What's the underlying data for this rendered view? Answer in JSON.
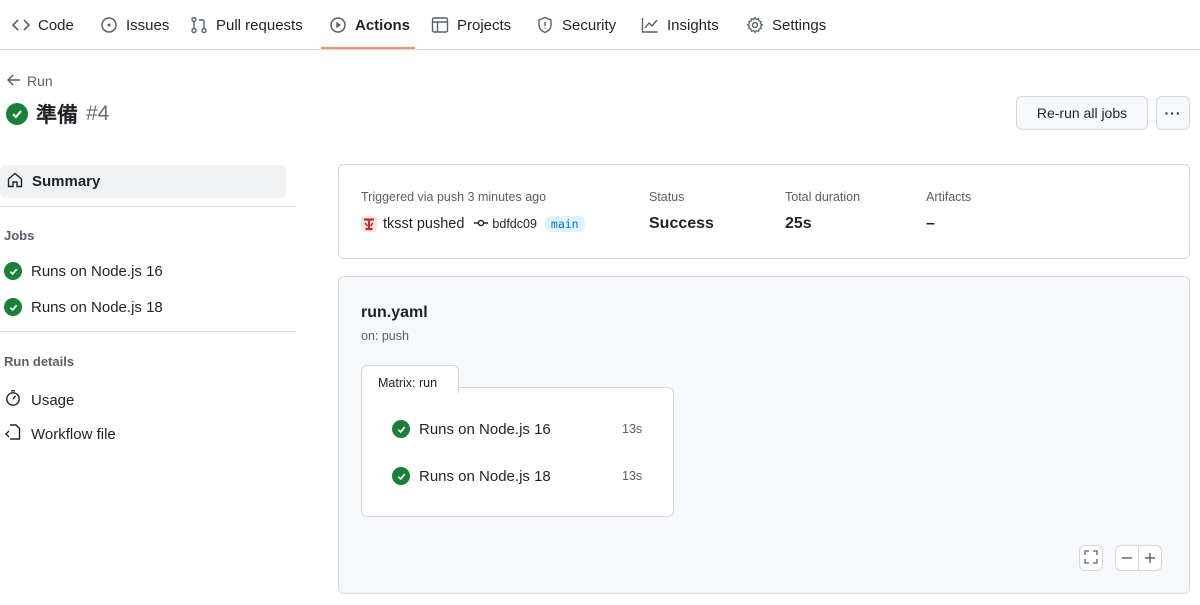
{
  "nav": {
    "tabs": [
      {
        "label": "Code",
        "icon": "code-icon"
      },
      {
        "label": "Issues",
        "icon": "issue-opened-icon"
      },
      {
        "label": "Pull requests",
        "icon": "git-pull-request-icon"
      },
      {
        "label": "Actions",
        "icon": "play-icon",
        "active": true
      },
      {
        "label": "Projects",
        "icon": "table-icon"
      },
      {
        "label": "Security",
        "icon": "shield-icon"
      },
      {
        "label": "Insights",
        "icon": "graph-icon"
      },
      {
        "label": "Settings",
        "icon": "gear-icon"
      }
    ]
  },
  "header": {
    "back_label": "Run",
    "run_name": "準備",
    "run_number": "#4",
    "rerun_label": "Re-run all jobs",
    "more_label": "···"
  },
  "sidebar": {
    "summary_label": "Summary",
    "jobs_heading": "Jobs",
    "jobs": [
      {
        "label": "Runs on Node.js 16",
        "status": "success"
      },
      {
        "label": "Runs on Node.js 18",
        "status": "success"
      }
    ],
    "details_heading": "Run details",
    "details": [
      {
        "label": "Usage",
        "icon": "stopwatch-icon"
      },
      {
        "label": "Workflow file",
        "icon": "file-code-icon"
      }
    ]
  },
  "summary": {
    "trigger_label": "Triggered via push 3 minutes ago",
    "actor_text": "tksst pushed",
    "commit": "bdfdc09",
    "branch": "main",
    "status_label": "Status",
    "status_value": "Success",
    "duration_label": "Total duration",
    "duration_value": "25s",
    "artifacts_label": "Artifacts",
    "artifacts_value": "–"
  },
  "workflow": {
    "file": "run.yaml",
    "trigger": "on: push",
    "matrix_label": "Matrix: run",
    "jobs": [
      {
        "label": "Runs on Node.js 16",
        "duration": "13s"
      },
      {
        "label": "Runs on Node.js 18",
        "duration": "13s"
      }
    ]
  },
  "colors": {
    "success": "#1a7f37",
    "active_tab_underline": "#fd8c73",
    "link": "#0969da"
  }
}
